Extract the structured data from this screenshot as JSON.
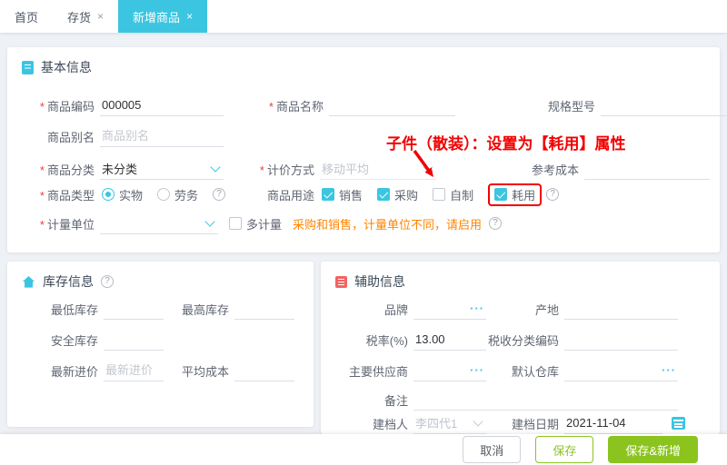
{
  "icons": {
    "close": "×",
    "ellipsis": "···",
    "help": "?"
  },
  "tabs": {
    "items": [
      {
        "label": "首页",
        "closable": false,
        "active": false
      },
      {
        "label": "存货",
        "closable": true,
        "active": false
      },
      {
        "label": "新增商品",
        "closable": true,
        "active": true
      }
    ]
  },
  "annotation": {
    "text": "子件（散装）：设置为【耗用】属性"
  },
  "basic": {
    "title": "基本信息",
    "code": {
      "label": "商品编码",
      "value": "000005",
      "required": true
    },
    "name": {
      "label": "商品名称",
      "required": true
    },
    "spec": {
      "label": "规格型号"
    },
    "alias": {
      "label": "商品别名",
      "placeholder": "商品别名"
    },
    "category": {
      "label": "商品分类",
      "value": "未分类",
      "required": true
    },
    "pricing": {
      "label": "计价方式",
      "value": "移动平均",
      "required": true,
      "disabled": true
    },
    "ref_cost": {
      "label": "参考成本"
    },
    "type": {
      "label": "商品类型",
      "required": true,
      "options": [
        {
          "label": "实物",
          "checked": true
        },
        {
          "label": "劳务",
          "checked": false
        }
      ]
    },
    "usage": {
      "label": "商品用途",
      "options": [
        {
          "label": "销售",
          "checked": true
        },
        {
          "label": "采购",
          "checked": true
        },
        {
          "label": "自制",
          "checked": false
        },
        {
          "label": "耗用",
          "checked": true,
          "highlighted": true
        }
      ]
    },
    "unit": {
      "label": "计量单位",
      "required": true,
      "value": ""
    },
    "multi_unit": {
      "label": "多计量",
      "checked": false
    },
    "unit_warning": "采购和销售，计量单位不同，请启用"
  },
  "inventory": {
    "title": "库存信息",
    "min_stock": {
      "label": "最低库存"
    },
    "max_stock": {
      "label": "最高库存"
    },
    "safety_stock": {
      "label": "安全库存"
    },
    "latest_price": {
      "label": "最新进价",
      "placeholder": "最新进价"
    },
    "avg_cost": {
      "label": "平均成本"
    }
  },
  "aux": {
    "title": "辅助信息",
    "brand": {
      "label": "品牌"
    },
    "origin": {
      "label": "产地"
    },
    "tax_rate": {
      "label": "税率(%)",
      "value": "13.00"
    },
    "tax_code": {
      "label": "税收分类编码"
    },
    "supplier": {
      "label": "主要供应商"
    },
    "warehouse": {
      "label": "默认仓库"
    },
    "remark": {
      "label": "备注"
    },
    "creator": {
      "label": "建档人",
      "value": "李四代1",
      "disabled": true
    },
    "create_date": {
      "label": "建档日期",
      "value": "2021-11-04"
    }
  },
  "footer": {
    "cancel": "取消",
    "save": "保存",
    "save_new": "保存&新增"
  },
  "colors": {
    "accent": "#3cc5e0",
    "green": "#8cc41f",
    "red": "#f20000",
    "orange": "#ff8400"
  }
}
